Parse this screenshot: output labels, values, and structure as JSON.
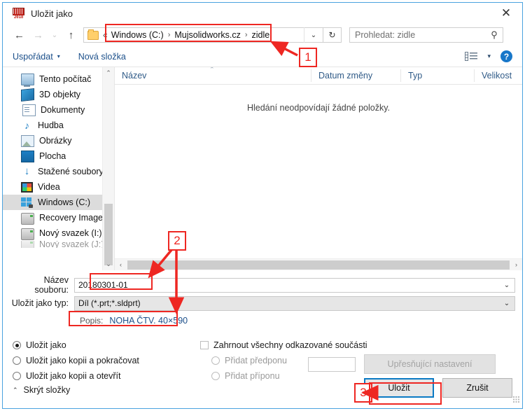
{
  "window": {
    "title": "Uložit jako",
    "app_icon": "solidworks-2018-icon",
    "icon_year": "2018",
    "close_label": "✕"
  },
  "nav": {
    "back_label": "←",
    "forward_label": "→",
    "recent_label": "⌄",
    "up_label": "↑",
    "address": {
      "overflow": "«",
      "crumbs": [
        "Windows (C:)",
        "Mujsolidworks.cz",
        "zidle"
      ],
      "separator": "›",
      "dropdown_label": "⌄"
    },
    "refresh_label": "↻",
    "search": {
      "placeholder": "Prohledat: zidle",
      "value": "",
      "icon": "search-icon"
    }
  },
  "toolbar": {
    "organize_label": "Uspořádat",
    "organize_caret": "▾",
    "new_folder_label": "Nová složka",
    "view_icon": "view-layout-icon",
    "view_caret": "▾",
    "help_icon": "help-icon",
    "help_glyph": "?"
  },
  "sidebar": {
    "items": [
      {
        "label": "Tento počítač",
        "icon": "computer-icon",
        "selected": false
      },
      {
        "label": "3D objekty",
        "icon": "3d-objects-icon",
        "selected": false
      },
      {
        "label": "Dokumenty",
        "icon": "documents-icon",
        "selected": false
      },
      {
        "label": "Hudba",
        "icon": "music-icon",
        "selected": false
      },
      {
        "label": "Obrázky",
        "icon": "pictures-icon",
        "selected": false
      },
      {
        "label": "Plocha",
        "icon": "desktop-icon",
        "selected": false
      },
      {
        "label": "Stažené soubory",
        "icon": "downloads-icon",
        "selected": false
      },
      {
        "label": "Videa",
        "icon": "videos-icon",
        "selected": false
      },
      {
        "label": "Windows (C:)",
        "icon": "windows-drive-icon",
        "selected": true
      },
      {
        "label": "Recovery Image",
        "icon": "drive-icon",
        "selected": false
      },
      {
        "label": "Nový svazek (I:)",
        "icon": "drive-icon",
        "selected": false
      },
      {
        "label": "Nový svazek (J:)",
        "icon": "drive-icon",
        "selected": false
      }
    ],
    "scroll_up": "⌃",
    "scroll_down": "⌄"
  },
  "filelist": {
    "columns": [
      "Název",
      "Datum změny",
      "Typ",
      "Velikost"
    ],
    "sort_indicator": "⌃",
    "rows": [],
    "empty_message": "Hledání neodpovídají žádné položky.",
    "hscroll_left": "‹",
    "hscroll_right": "›"
  },
  "form": {
    "filename_label": "Název souboru:",
    "filename_value": "20180301-01",
    "filetype_label": "Uložit jako typ:",
    "filetype_value": "Díl (*.prt;*.sldprt)",
    "dropdown_caret": "⌄",
    "description_label": "Popis:",
    "description_value": "NOHA ČTV. 40×590"
  },
  "options": {
    "save_modes": [
      {
        "label": "Uložit jako",
        "selected": true
      },
      {
        "label": "Uložit jako kopii a pokračovat",
        "selected": false
      },
      {
        "label": "Uložit jako kopii a otevřít",
        "selected": false
      }
    ],
    "include_referenced": {
      "label": "Zahrnout všechny odkazované součásti",
      "checked": false
    },
    "add_prefix": {
      "label": "Přidat předponu",
      "selected": false,
      "disabled": true
    },
    "add_suffix": {
      "label": "Přidat příponu",
      "selected": false,
      "disabled": true
    },
    "affix_input_value": "",
    "advanced_button": {
      "label": "Upřesňující nastavení",
      "disabled": true
    },
    "hide_folders": {
      "label": "Skrýt složky",
      "caret": "⌃"
    },
    "save_button": "Uložit",
    "cancel_button": "Zrušit"
  },
  "annotations": {
    "accent_color": "#ee2722",
    "focus_color": "#0b7ac4",
    "markers": [
      {
        "number": "1",
        "target": "address-bar"
      },
      {
        "number": "2",
        "target": "filename-and-description"
      },
      {
        "number": "3",
        "target": "save-button"
      }
    ]
  }
}
